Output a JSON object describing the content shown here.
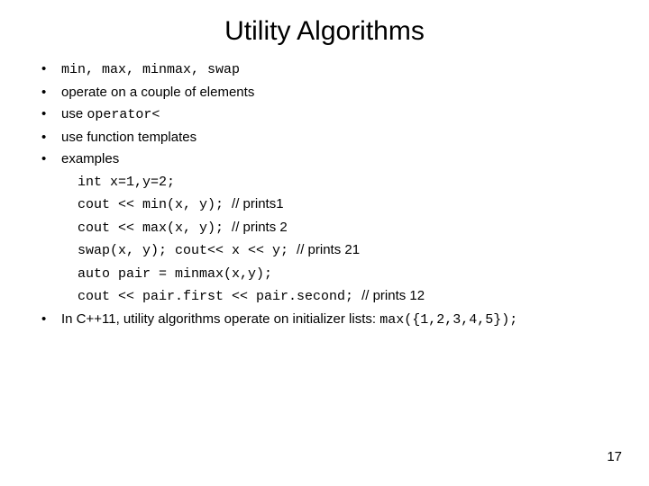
{
  "title": "Utility Algorithms",
  "bullets": {
    "b1_code": "min, max, minmax, swap",
    "b2": "operate on a couple of elements",
    "b3_prefix": "use ",
    "b3_code": "operator<",
    "b4": "use function templates",
    "b5": "examples"
  },
  "examples": {
    "l1": "int x=1,y=2;",
    "l2_code": "cout << min(x, y); ",
    "l2_cmt": "// prints1",
    "l3_code": "cout << max(x, y);  ",
    "l3_cmt": "// prints 2",
    "l4_code": "swap(x, y); cout<< x << y; ",
    "l4_cmt": "// prints 21",
    "l5": "auto pair = minmax(x,y);",
    "l6_code": "cout << pair.first << pair.second; ",
    "l6_cmt": "// prints 12"
  },
  "footnote": {
    "text": "In C++11, utility algorithms operate on initializer lists: ",
    "code": "max({1,2,3,4,5});"
  },
  "page_number": "17"
}
